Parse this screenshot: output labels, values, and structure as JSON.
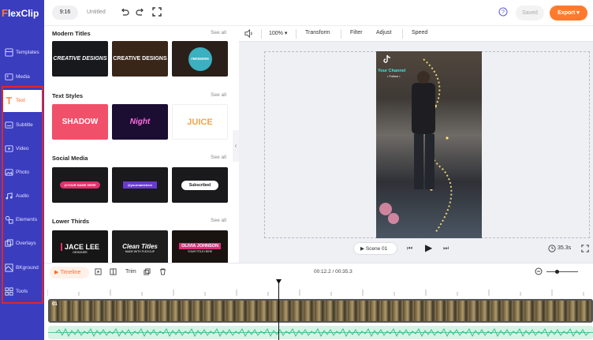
{
  "app": {
    "logo_text": "lexClip",
    "logo_letter": "F",
    "accent": "#ff7a2d",
    "sidebar_color": "#3b3dbf"
  },
  "sidebar": {
    "items": [
      {
        "label": "Templates",
        "icon": "template-icon"
      },
      {
        "label": "Media",
        "icon": "media-icon"
      },
      {
        "label": "Text",
        "icon": "text-icon",
        "active": true
      },
      {
        "label": "Subtitle",
        "icon": "subtitle-icon"
      },
      {
        "label": "Video",
        "icon": "video-icon"
      },
      {
        "label": "Photo",
        "icon": "photo-icon"
      },
      {
        "label": "Audio",
        "icon": "audio-icon"
      },
      {
        "label": "Elements",
        "icon": "elements-icon"
      },
      {
        "label": "Overlays",
        "icon": "overlays-icon"
      },
      {
        "label": "BKground",
        "icon": "background-icon"
      },
      {
        "label": "Tools",
        "icon": "tools-icon"
      }
    ]
  },
  "topbar": {
    "ratio": "9:16",
    "title": "Untitled",
    "saved": "Saved",
    "export": "Export"
  },
  "library": {
    "see_all": "See all",
    "categories": [
      {
        "title": "Modern Titles",
        "thumbs": [
          "CREATIVE DESIGNS",
          "CREATIVE DESIGNS",
          "#MODERN"
        ]
      },
      {
        "title": "Text Styles",
        "thumbs": [
          "SHADOW",
          "Night",
          "JUICE"
        ]
      },
      {
        "title": "Social Media",
        "thumbs": [
          "@YOUR NAME HERE",
          "@yournamehere",
          "Subscribed"
        ]
      },
      {
        "title": "Lower Thirds",
        "thumbs": [
          "JACE LEE",
          "Clean Titles",
          "OLIVIA JOHNSON"
        ]
      }
    ],
    "thumb_sub": {
      "jace": "DESIGNER",
      "clean": "MADE WITH FLEXCLIP",
      "olivia": "YOUR TITLE HERE"
    }
  },
  "preview": {
    "zoom": "100%",
    "tools": [
      "Transform",
      "Filter",
      "Adjust",
      "Speed"
    ],
    "channel": "Your Channel",
    "follow": "• Follow •",
    "scene": "Scene 01",
    "duration": "35.3s"
  },
  "timeline": {
    "tab": "Timeline",
    "trim": "Trim",
    "time": "00:12.2 / 00:35.3",
    "track_label": "01"
  }
}
